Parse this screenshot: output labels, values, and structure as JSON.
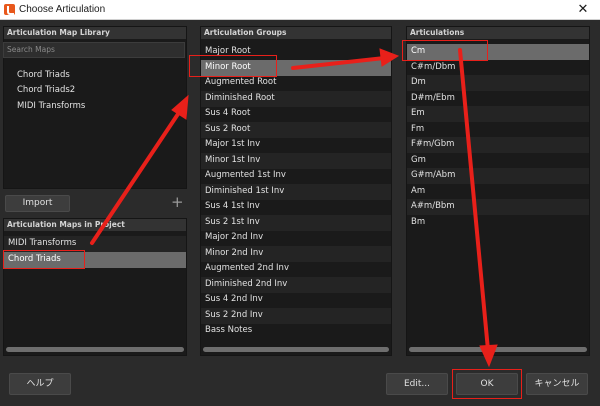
{
  "window": {
    "title": "Choose Articulation",
    "close_glyph": "✕"
  },
  "library": {
    "header": "Articulation Map Library",
    "search_placeholder": "Search Maps",
    "items": [
      "Chord Triads",
      "Chord Triads2",
      "MIDI Transforms"
    ]
  },
  "import_label": "Import",
  "project_maps": {
    "header": "Articulation Maps in Project",
    "items": [
      "MIDI Transforms",
      "Chord Triads"
    ],
    "selected_index": 1
  },
  "groups": {
    "header": "Articulation Groups",
    "items": [
      "Major Root",
      "Minor Root",
      "Augmented Root",
      "Diminished Root",
      "Sus 4 Root",
      "Sus 2 Root",
      "Major 1st Inv",
      "Minor 1st Inv",
      "Augmented 1st Inv",
      "Diminished 1st Inv",
      "Sus 4 1st Inv",
      "Sus 2 1st Inv",
      "Major 2nd Inv",
      "Minor 2nd Inv",
      "Augmented 2nd Inv",
      "Diminished 2nd Inv",
      "Sus 4 2nd Inv",
      "Sus 2 2nd Inv",
      "Bass Notes"
    ],
    "selected_index": 1
  },
  "articulations": {
    "header": "Articulations",
    "items": [
      "Cm",
      "C#m/Dbm",
      "Dm",
      "D#m/Ebm",
      "Em",
      "Fm",
      "F#m/Gbm",
      "Gm",
      "G#m/Abm",
      "Am",
      "A#m/Bbm",
      "Bm"
    ],
    "selected_index": 0
  },
  "footer": {
    "help_label": "ヘルプ",
    "edit_label": "Edit...",
    "ok_label": "OK",
    "cancel_label": "キャンセル"
  },
  "colors": {
    "background": "#2b2b2b",
    "list_background": "#1a1a1a",
    "selection": "#6b6b6b",
    "annotation_red": "#e8201a"
  },
  "icons": [
    "app-logo-icon",
    "close-icon",
    "add-icon"
  ]
}
